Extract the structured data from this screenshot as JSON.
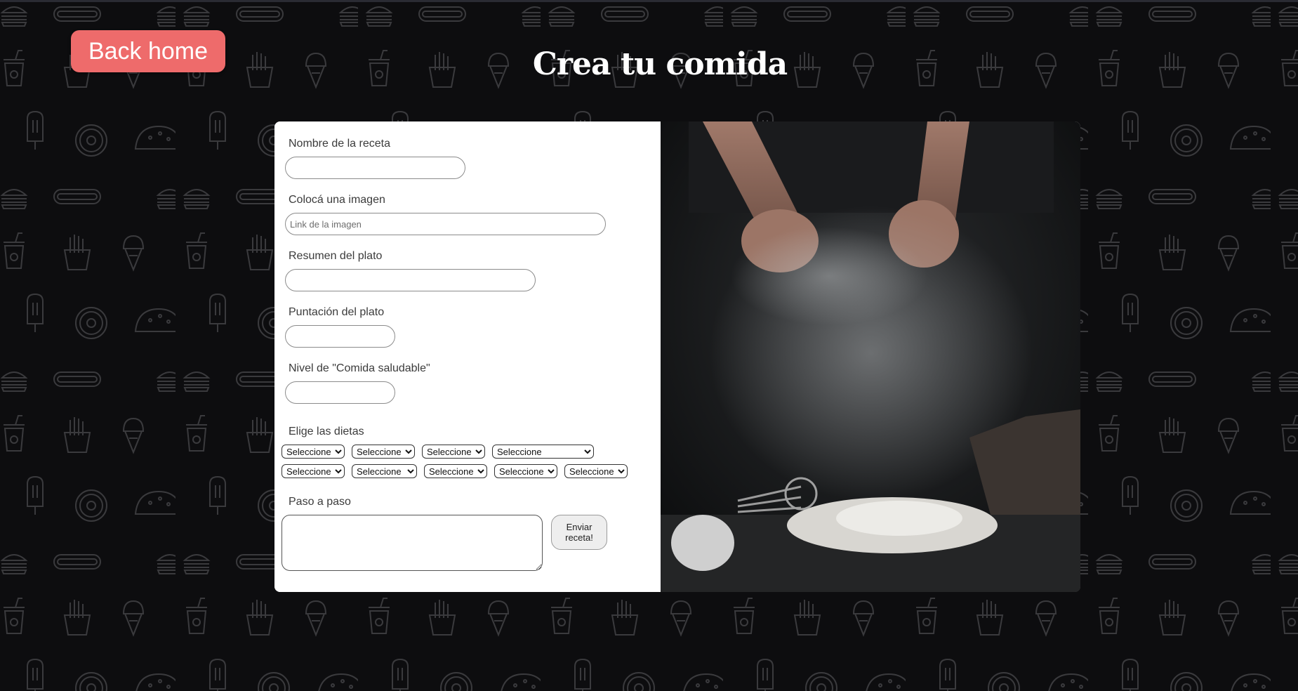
{
  "header": {
    "back_button": "Back home",
    "title": "Crea tu comida"
  },
  "form": {
    "name": {
      "label": "Nombre de la receta",
      "value": "",
      "placeholder": ""
    },
    "image": {
      "label": "Colocá una imagen",
      "value": "",
      "placeholder": "Link de la imagen"
    },
    "summary": {
      "label": "Resumen del plato",
      "value": "",
      "placeholder": ""
    },
    "score": {
      "label": "Puntación del plato",
      "value": ""
    },
    "health": {
      "label": "Nivel de \"Comida saludable\"",
      "value": ""
    },
    "diets": {
      "label": "Elige las dietas",
      "selects": [
        "Seleccione",
        "Seleccione",
        "Seleccione",
        "Seleccione",
        "Seleccione",
        "Seleccione",
        "Seleccione",
        "Seleccione",
        "Seleccione"
      ]
    },
    "steps": {
      "label": "Paso a paso",
      "value": ""
    },
    "submit_label": "Enviar receta!"
  },
  "image_panel": {
    "icon": "baker-flour-photo"
  },
  "colors": {
    "background": "#0d0d0f",
    "pattern_stroke": "#3a3a3d",
    "accent": "#ee6b6b",
    "card": "#ffffff"
  }
}
